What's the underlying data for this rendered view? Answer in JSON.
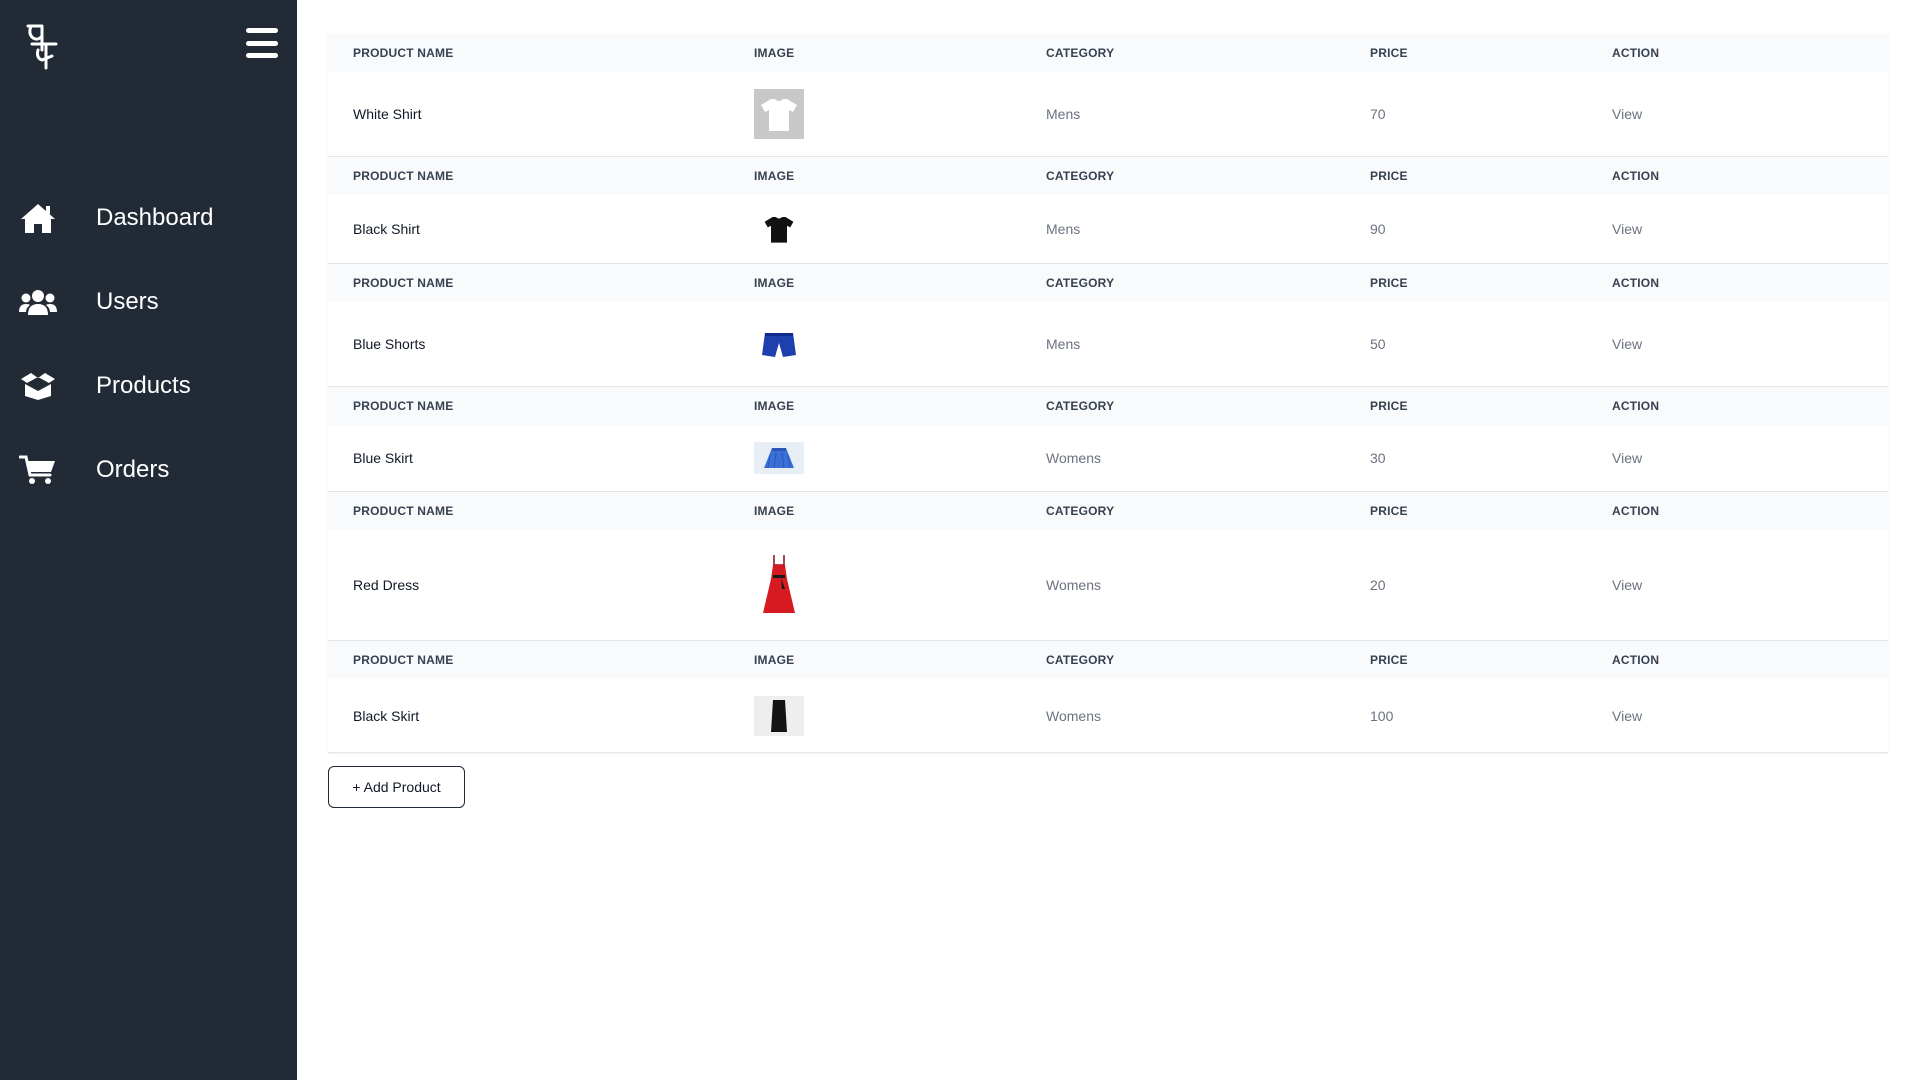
{
  "sidebar": {
    "nav": [
      {
        "label": "Dashboard",
        "icon": "home-icon"
      },
      {
        "label": "Users",
        "icon": "users-icon"
      },
      {
        "label": "Products",
        "icon": "box-icon"
      },
      {
        "label": "Orders",
        "icon": "cart-icon"
      }
    ]
  },
  "table": {
    "headers": {
      "name": "PRODUCT NAME",
      "image": "IMAGE",
      "category": "CATEGORY",
      "price": "PRICE",
      "action": "ACTION"
    },
    "products": [
      {
        "name": "White Shirt",
        "category": "Mens",
        "price": "70",
        "action": "View",
        "image": "white-shirt-image"
      },
      {
        "name": "Black Shirt",
        "category": "Mens",
        "price": "90",
        "action": "View",
        "image": "black-shirt-image"
      },
      {
        "name": "Blue Shorts",
        "category": "Mens",
        "price": "50",
        "action": "View",
        "image": "blue-shorts-image"
      },
      {
        "name": "Blue Skirt",
        "category": "Womens",
        "price": "30",
        "action": "View",
        "image": "blue-skirt-image"
      },
      {
        "name": "Red Dress",
        "category": "Womens",
        "price": "20",
        "action": "View",
        "image": "red-dress-image"
      },
      {
        "name": "Black Skirt",
        "category": "Womens",
        "price": "100",
        "action": "View",
        "image": "black-skirt-image"
      }
    ]
  },
  "add_button": {
    "label": "+ Add Product"
  },
  "colors": {
    "sidebar_bg": "#222a36",
    "header_bg": "#f9fafb",
    "text_dark": "#111827",
    "text_muted": "#6b7280"
  }
}
